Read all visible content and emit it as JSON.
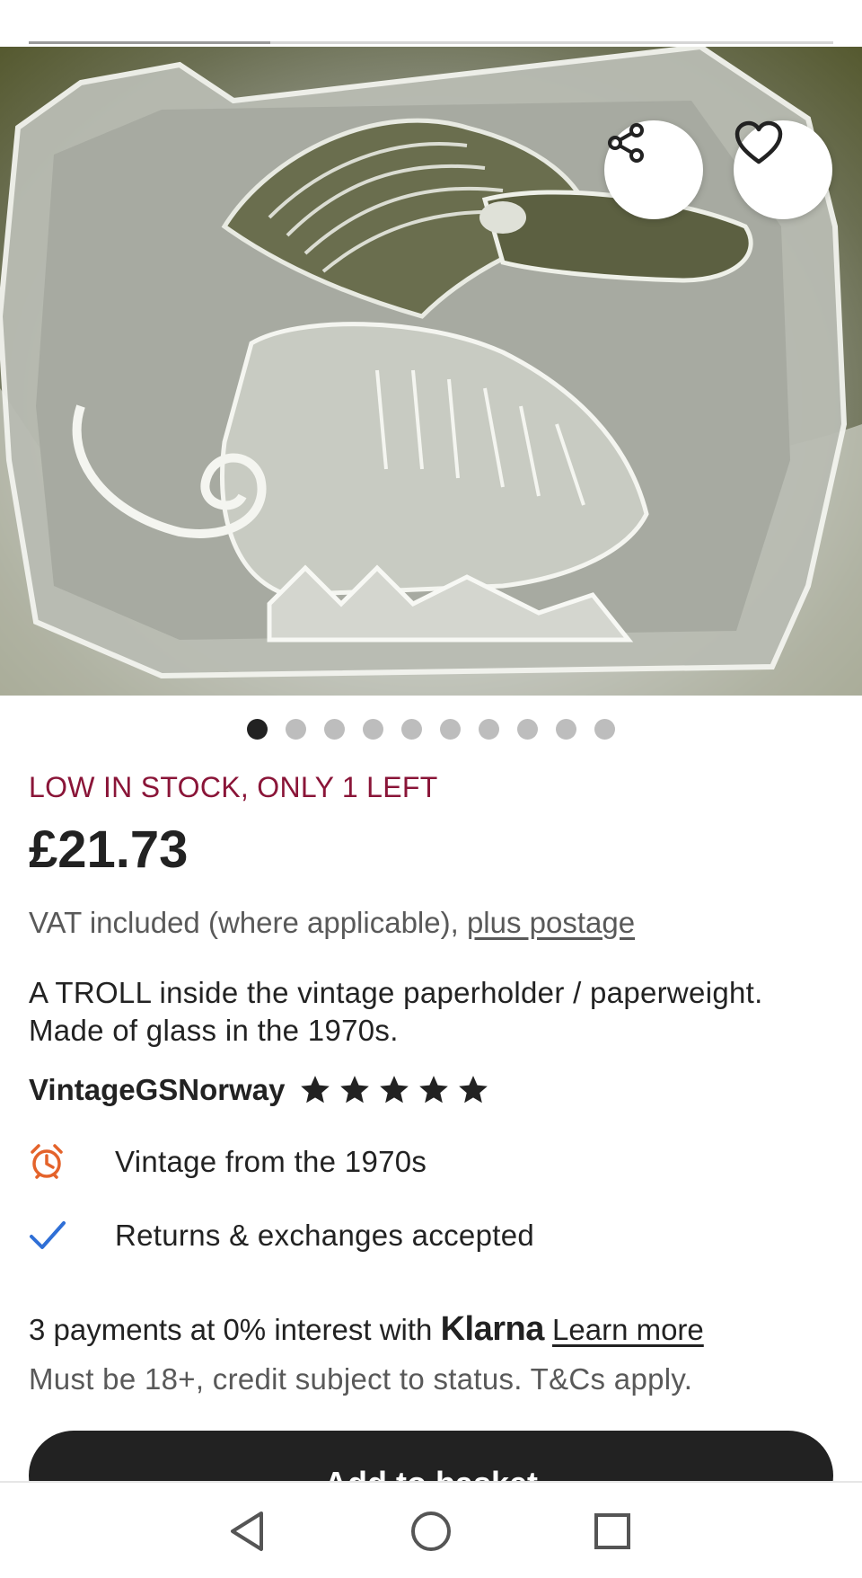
{
  "gallery": {
    "image_position": 1,
    "image_count": 10,
    "progress": 0.3
  },
  "actions": {
    "share_icon": "share-icon",
    "favourite_icon": "heart-icon"
  },
  "listing": {
    "stock_notice": "LOW IN STOCK, ONLY 1 LEFT",
    "price": "£21.73",
    "vat_text": "VAT included (where applicable), ",
    "postage_link": "plus postage",
    "description": "A TROLL inside the vintage paperholder / paperweight. Made of glass in the 1970s."
  },
  "shop": {
    "name": "VintageGSNorway",
    "rating": 5,
    "rating_max": 5
  },
  "features": [
    {
      "icon": "alarm-clock-icon",
      "text": "Vintage from the 1970s"
    },
    {
      "icon": "checkmark-icon",
      "text": "Returns & exchanges accepted"
    }
  ],
  "payment": {
    "prefix": "3 payments at 0% interest with ",
    "brand": "Klarna",
    "learn_more": "Learn more",
    "disclaimer": "Must be 18+, credit subject to status. T&Cs apply."
  },
  "cta": {
    "add_to_basket": "Add to basket"
  },
  "system_nav": {
    "back": "back-triangle-icon",
    "home": "home-circle-icon",
    "recents": "recents-square-icon"
  },
  "colors": {
    "stock_accent": "#8a1538",
    "text_primary": "#222222",
    "text_secondary": "#595959",
    "check_blue": "#2f6fd6",
    "alarm_orange": "#e4632b",
    "button_dark": "#222222"
  }
}
